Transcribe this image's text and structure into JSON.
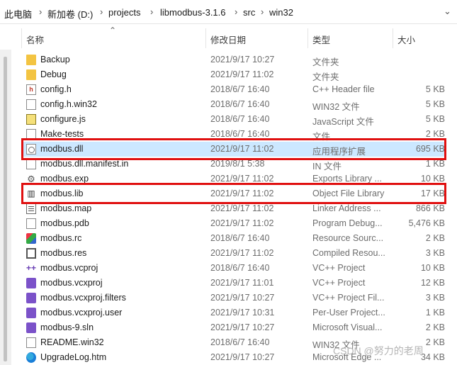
{
  "breadcrumb": [
    "此电脑",
    "新加卷 (D:)",
    "projects",
    "libmodbus-3.1.6",
    "src",
    "win32"
  ],
  "columns": {
    "name": "名称",
    "date": "修改日期",
    "type": "类型",
    "size": "大小"
  },
  "files": [
    {
      "name": "Backup",
      "date": "2021/9/17 10:27",
      "type": "文件夹",
      "size": "",
      "icon": "folder-icon"
    },
    {
      "name": "Debug",
      "date": "2021/9/17 11:02",
      "type": "文件夹",
      "size": "",
      "icon": "folder-icon"
    },
    {
      "name": "config.h",
      "date": "2018/6/7 16:40",
      "type": "C++ Header file",
      "size": "5 KB",
      "icon": "header-file-icon"
    },
    {
      "name": "config.h.win32",
      "date": "2018/6/7 16:40",
      "type": "WIN32 文件",
      "size": "5 KB",
      "icon": "file-icon"
    },
    {
      "name": "configure.js",
      "date": "2018/6/7 16:40",
      "type": "JavaScript 文件",
      "size": "5 KB",
      "icon": "javascript-file-icon"
    },
    {
      "name": "Make-tests",
      "date": "2018/6/7 16:40",
      "type": "文件",
      "size": "2 KB",
      "icon": "file-icon"
    },
    {
      "name": "modbus.dll",
      "date": "2021/9/17 11:02",
      "type": "应用程序扩展",
      "size": "695 KB",
      "icon": "dll-icon"
    },
    {
      "name": "modbus.dll.manifest.in",
      "date": "2019/8/1 5:38",
      "type": "IN 文件",
      "size": "1 KB",
      "icon": "file-icon"
    },
    {
      "name": "modbus.exp",
      "date": "2021/9/17 11:02",
      "type": "Exports Library ...",
      "size": "10 KB",
      "icon": "gear-icon"
    },
    {
      "name": "modbus.lib",
      "date": "2021/9/17 11:02",
      "type": "Object File Library",
      "size": "17 KB",
      "icon": "library-icon"
    },
    {
      "name": "modbus.map",
      "date": "2021/9/17 11:02",
      "type": "Linker Address ...",
      "size": "866 KB",
      "icon": "map-file-icon"
    },
    {
      "name": "modbus.pdb",
      "date": "2021/9/17 11:02",
      "type": "Program Debug...",
      "size": "5,476 KB",
      "icon": "file-icon"
    },
    {
      "name": "modbus.rc",
      "date": "2018/6/7 16:40",
      "type": "Resource Sourc...",
      "size": "2 KB",
      "icon": "resource-script-icon"
    },
    {
      "name": "modbus.res",
      "date": "2021/9/17 11:02",
      "type": "Compiled Resou...",
      "size": "3 KB",
      "icon": "compiled-resource-icon"
    },
    {
      "name": "modbus.vcproj",
      "date": "2018/6/7 16:40",
      "type": "VC++ Project",
      "size": "10 KB",
      "icon": "vcproj-icon"
    },
    {
      "name": "modbus.vcxproj",
      "date": "2021/9/17 11:01",
      "type": "VC++ Project",
      "size": "12 KB",
      "icon": "vcxproj-icon"
    },
    {
      "name": "modbus.vcxproj.filters",
      "date": "2021/9/17 10:27",
      "type": "VC++ Project Fil...",
      "size": "3 KB",
      "icon": "vcxproj-filters-icon"
    },
    {
      "name": "modbus.vcxproj.user",
      "date": "2021/9/17 10:31",
      "type": "Per-User Project...",
      "size": "1 KB",
      "icon": "vcxproj-user-icon"
    },
    {
      "name": "modbus-9.sln",
      "date": "2021/9/17 10:27",
      "type": "Microsoft Visual...",
      "size": "2 KB",
      "icon": "visual-studio-solution-icon"
    },
    {
      "name": "README.win32",
      "date": "2018/6/7 16:40",
      "type": "WIN32 文件",
      "size": "2 KB",
      "icon": "file-icon"
    },
    {
      "name": "UpgradeLog.htm",
      "date": "2021/9/17 10:27",
      "type": "Microsoft Edge ...",
      "size": "34 KB",
      "icon": "edge-browser-icon"
    }
  ],
  "selected_row": 6,
  "highlighted_rows": [
    6,
    9
  ],
  "watermark": "CSDN @努力的老周",
  "colors": {
    "highlight_border": "#e01010",
    "selection": "#cce8ff"
  }
}
